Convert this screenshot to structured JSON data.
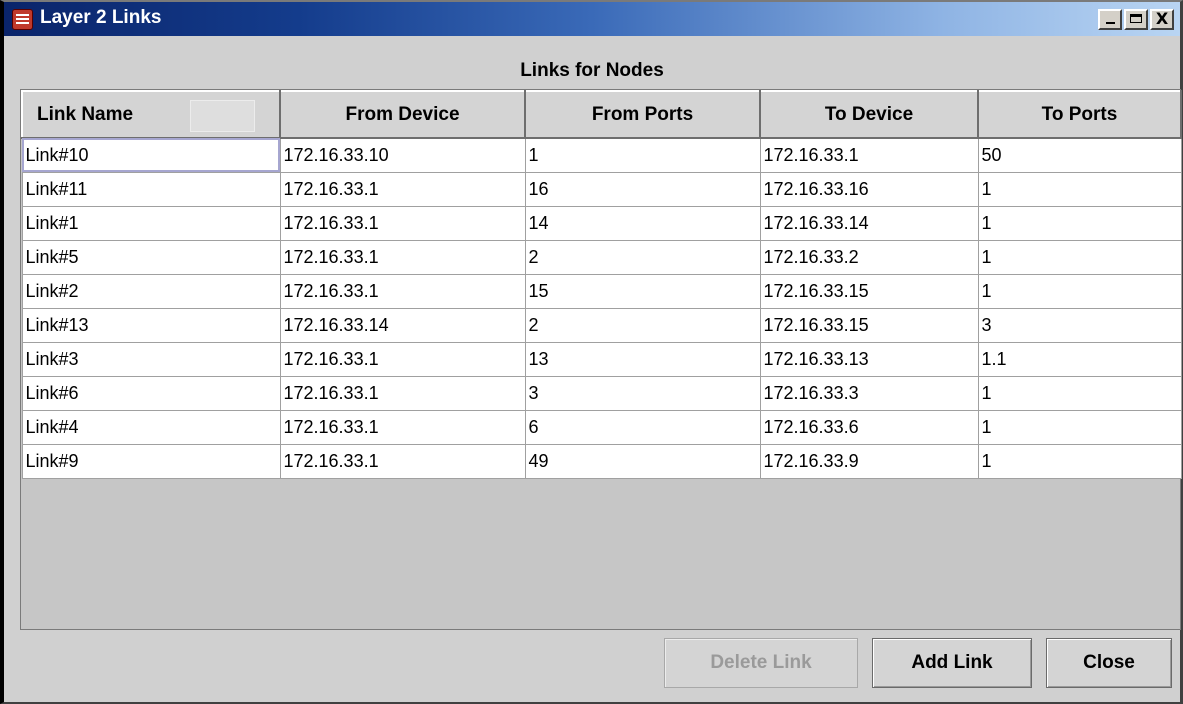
{
  "window": {
    "title": "Layer 2 Links",
    "close_glyph": "X"
  },
  "caption": "Links for Nodes",
  "table": {
    "columns": [
      "Link Name",
      "From Device",
      "From Ports",
      "To Device",
      "To Ports"
    ],
    "rows": [
      [
        "Link#10",
        "172.16.33.10",
        "1",
        "172.16.33.1",
        "50"
      ],
      [
        "Link#11",
        "172.16.33.1",
        "16",
        "172.16.33.16",
        "1"
      ],
      [
        "Link#1",
        "172.16.33.1",
        "14",
        "172.16.33.14",
        "1"
      ],
      [
        "Link#5",
        "172.16.33.1",
        "2",
        "172.16.33.2",
        "1"
      ],
      [
        "Link#2",
        "172.16.33.1",
        "15",
        "172.16.33.15",
        "1"
      ],
      [
        "Link#13",
        "172.16.33.14",
        "2",
        "172.16.33.15",
        "3"
      ],
      [
        "Link#3",
        "172.16.33.1",
        "13",
        "172.16.33.13",
        "1.1"
      ],
      [
        "Link#6",
        "172.16.33.1",
        "3",
        "172.16.33.3",
        "1"
      ],
      [
        "Link#4",
        "172.16.33.1",
        "6",
        "172.16.33.6",
        "1"
      ],
      [
        "Link#9",
        "172.16.33.1",
        "49",
        "172.16.33.9",
        "1"
      ]
    ]
  },
  "buttons": {
    "delete": {
      "label": "Delete Link",
      "enabled": false
    },
    "add": {
      "label": "Add Link",
      "enabled": true
    },
    "close": {
      "label": "Close",
      "enabled": true
    }
  },
  "icons": {
    "app": "app-icon",
    "minimize": "minimize-icon",
    "maximize": "maximize-icon",
    "close": "close-icon"
  },
  "colors": {
    "title_gradient_start": "#0a246a",
    "title_gradient_end": "#b9d5f3",
    "background": "#d0d0d0"
  }
}
